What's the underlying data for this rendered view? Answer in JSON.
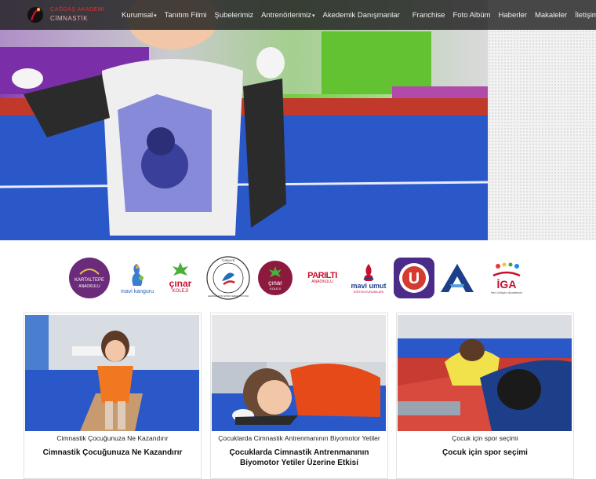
{
  "brand": {
    "line1": "ÇAĞDAŞ AKADEMİ",
    "line2": "CİMNASTİK"
  },
  "nav": {
    "items": [
      {
        "label": "Kurumsal",
        "dropdown": true
      },
      {
        "label": "Tanıtım Filmi",
        "dropdown": false
      },
      {
        "label": "Şubelerimiz",
        "dropdown": false
      },
      {
        "label": "Antrenörlerimiz",
        "dropdown": true
      },
      {
        "label": "Akedemik Danışmanlar",
        "dropdown": false
      },
      {
        "label": "Franchise",
        "dropdown": false
      },
      {
        "label": "Foto Albüm",
        "dropdown": false
      },
      {
        "label": "Haberler",
        "dropdown": false
      },
      {
        "label": "Makaleler",
        "dropdown": false
      },
      {
        "label": "İletişim",
        "dropdown": false
      }
    ]
  },
  "sponsors": {
    "kartaltepe": {
      "line1": "KARTALTEPE",
      "line2": "ANAOKULU"
    },
    "mavi_kanguru": {
      "line1": "mavi kanguru"
    },
    "cinar1": {
      "line1": "çınar",
      "line2": "KOLEJİ"
    },
    "federation": {
      "line1": "TÜRKİYE",
      "line2": "HERKES İÇİN SPOR FEDERASYONU"
    },
    "cinar2": {
      "line1": "çınar",
      "line2": "KOLEJİ"
    },
    "parilti": {
      "line1": "PARILTI",
      "line2": "ANAOKULU"
    },
    "mavi_umut": {
      "line1": "mavi umut",
      "line2": "EĞİTİM KURUMLARI"
    },
    "u_logo": {
      "letter": "U"
    },
    "iga": {
      "line1": "İGA",
      "line2": "İleri Gelişim Akademisi"
    }
  },
  "cards": [
    {
      "category": "Cimnastik Çocuğunuza Ne Kazandırır",
      "title": "Cimnastik Çocuğunuza Ne Kazandırır"
    },
    {
      "category": "Çocuklarda Cimnastik Antrenmanının Biyomotor Yetiler",
      "title": "Çocuklarda Cimnastik Antrenmanının Biyomotor Yetiler Üzerine Etkisi"
    },
    {
      "category": "Çocuk için spor seçimi",
      "title": "Çocuk için spor seçimi"
    }
  ],
  "colors": {
    "nav_bg": "#1e1e1e",
    "accent_red": "#c8102e",
    "mat_blue": "#2a58c8"
  }
}
